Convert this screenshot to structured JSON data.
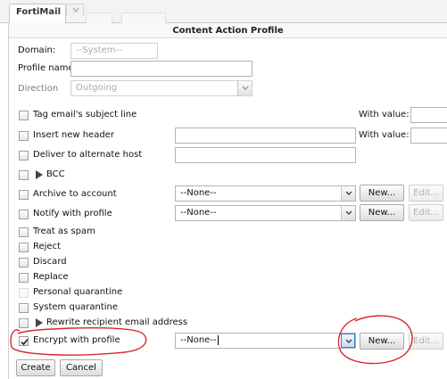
{
  "window": {
    "tab_title": "FortiMail"
  },
  "page": {
    "title": "Content Action Profile"
  },
  "form": {
    "domain": {
      "label": "Domain:",
      "value": "--System--"
    },
    "profile_name": {
      "label": "Profile name:",
      "value": ""
    },
    "direction": {
      "label": "Direction",
      "value": "Outgoing"
    }
  },
  "actions": {
    "tag_subject": {
      "label": "Tag email's subject line",
      "with_value_label": "With value:",
      "checked": false
    },
    "insert_header": {
      "label": "Insert new header",
      "with_value_label": "With value:",
      "checked": false
    },
    "alternate_host": {
      "label": "Deliver to alternate host",
      "checked": false
    },
    "bcc": {
      "label": "BCC",
      "checked": false
    },
    "archive": {
      "label": "Archive to account",
      "select_value": "--None--",
      "new_label": "New...",
      "edit_label": "Edit...",
      "checked": false
    },
    "notify": {
      "label": "Notify with profile",
      "select_value": "--None--",
      "new_label": "New...",
      "edit_label": "Edit...",
      "checked": false
    },
    "treat_spam": {
      "label": "Treat as spam",
      "checked": false
    },
    "reject": {
      "label": "Reject",
      "checked": false
    },
    "discard": {
      "label": "Discard",
      "checked": false
    },
    "replace": {
      "label": "Replace",
      "checked": false
    },
    "personal_quarantine": {
      "label": "Personal quarantine",
      "checked": false
    },
    "system_quarantine": {
      "label": "System quarantine",
      "checked": false
    },
    "rewrite_recipient": {
      "label": "Rewrite recipient email address",
      "checked": false
    },
    "encrypt": {
      "label": "Encrypt with profile",
      "select_value": "--None--",
      "new_label": "New...",
      "edit_label": "Edit...",
      "checked": true
    }
  },
  "footer": {
    "create_label": "Create",
    "cancel_label": "Cancel"
  },
  "colors": {
    "annotation_red": "#d6272e"
  }
}
